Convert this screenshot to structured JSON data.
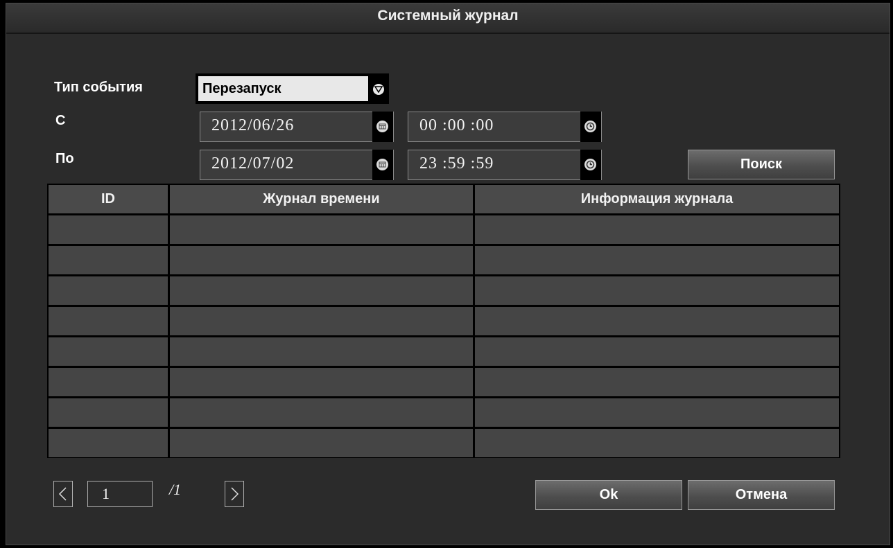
{
  "window": {
    "title": "Системный журнал"
  },
  "filters": {
    "event_type_label": "Тип события",
    "event_type_value": "Перезапуск",
    "from_label": "С",
    "to_label": "По",
    "from_date": "2012/06/26",
    "from_time": "00 :00 :00",
    "to_date": "2012/07/02",
    "to_time": "23 :59 :59",
    "search_label": "Поиск"
  },
  "table": {
    "columns": [
      "ID",
      "Журнал времени",
      "Информация журнала"
    ],
    "rows": [
      [
        "",
        "",
        ""
      ],
      [
        "",
        "",
        ""
      ],
      [
        "",
        "",
        ""
      ],
      [
        "",
        "",
        ""
      ],
      [
        "",
        "",
        ""
      ],
      [
        "",
        "",
        ""
      ],
      [
        "",
        "",
        ""
      ],
      [
        "",
        "",
        ""
      ]
    ]
  },
  "pager": {
    "current": "1",
    "total": "/1"
  },
  "footer": {
    "ok_label": "Ok",
    "cancel_label": "Отмена"
  },
  "icons": {
    "dropdown": "chevron-down-icon",
    "date": "calendar-icon",
    "time": "clock-icon",
    "prev": "chevron-left-icon",
    "next": "chevron-right-icon"
  }
}
